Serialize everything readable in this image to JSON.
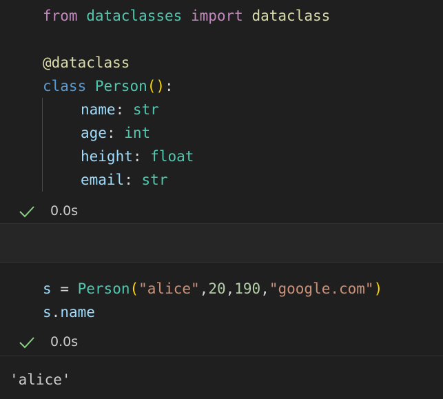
{
  "cell1": {
    "lines": {
      "import": {
        "kw_from": "from",
        "module": "dataclasses",
        "kw_import": "import",
        "name": "dataclass"
      },
      "decorator": "@dataclass",
      "classdef": {
        "kw": "class",
        "name": "Person",
        "open": "(",
        "close": ")",
        "colon": ":"
      },
      "fields": [
        {
          "name": "name",
          "colon": ":",
          "type": "str"
        },
        {
          "name": "age",
          "colon": ":",
          "type": "int"
        },
        {
          "name": "height",
          "colon": ":",
          "type": "float"
        },
        {
          "name": "email",
          "colon": ":",
          "type": "str"
        }
      ]
    },
    "status": {
      "icon": "check-icon",
      "time": "0.0s"
    }
  },
  "cell2": {
    "lines": {
      "assign": {
        "var": "s",
        "op": "=",
        "call": "Person",
        "open": "(",
        "arg1": "\"alice\"",
        "comma1": ",",
        "arg2": "20",
        "comma2": ",",
        "arg3": "190",
        "comma3": ",",
        "arg4": "\"google.com\"",
        "close": ")"
      },
      "attr": {
        "var": "s",
        "dot": ".",
        "attr": "name"
      }
    },
    "status": {
      "icon": "check-icon",
      "time": "0.0s"
    },
    "output": "'alice'"
  },
  "colors": {
    "background": "#1f1f1f",
    "success": "#89d185"
  }
}
